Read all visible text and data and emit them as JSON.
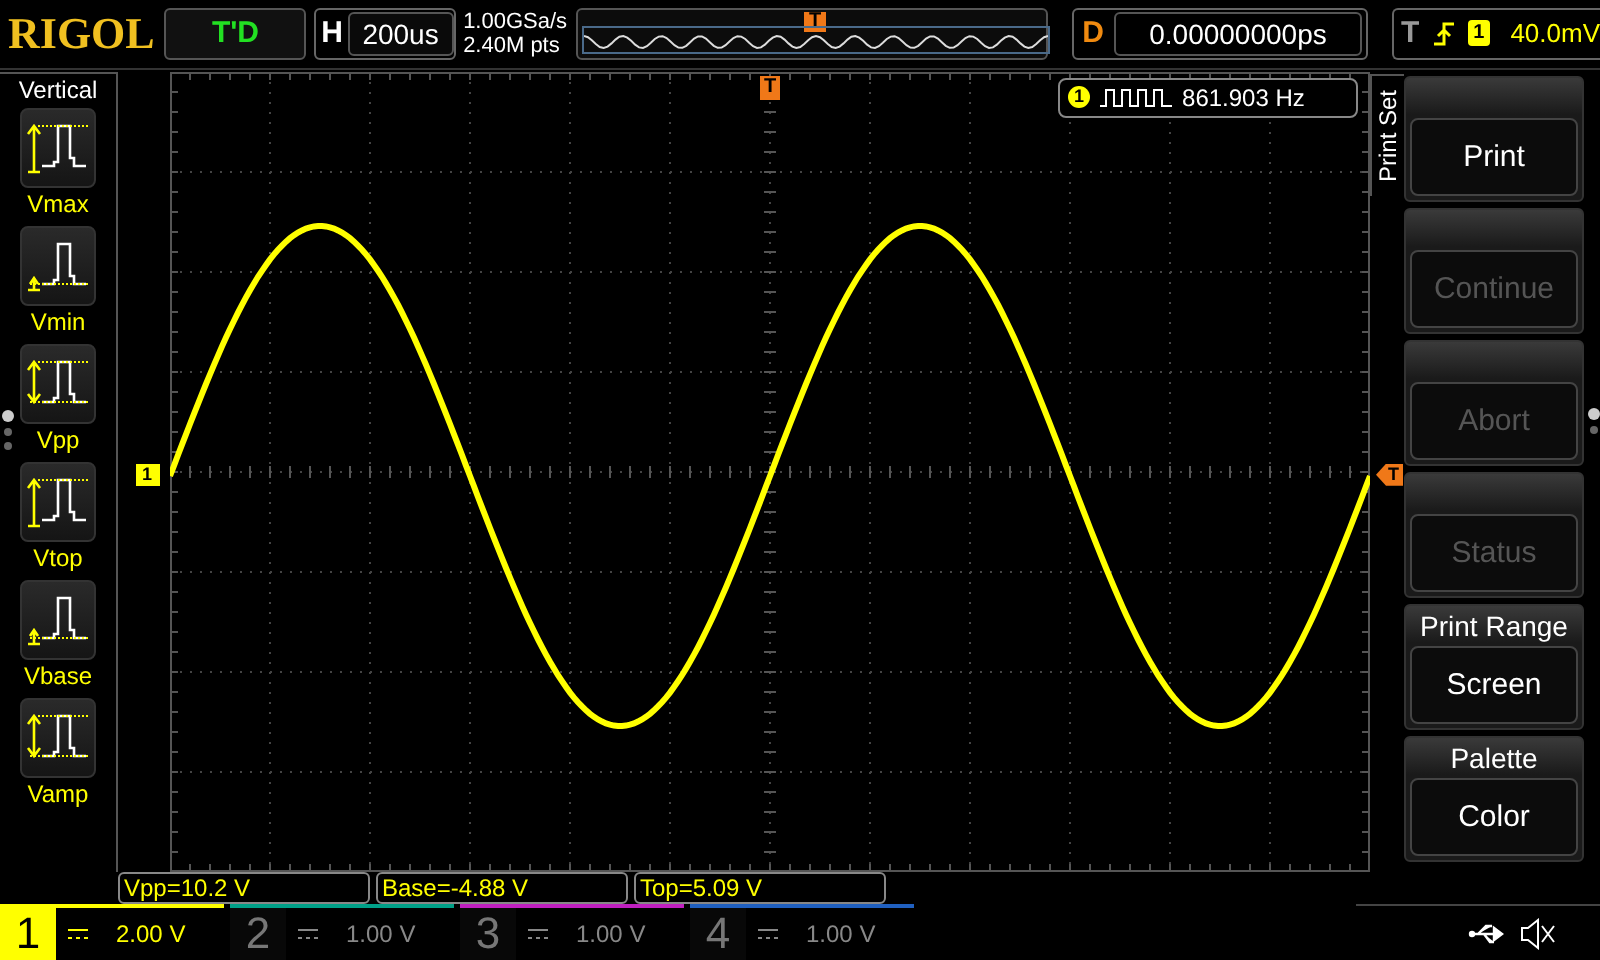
{
  "top_bar": {
    "logo": "RIGOL",
    "run_status": "T'D",
    "timebase": {
      "label": "H",
      "value": "200us"
    },
    "sample_rate": "1.00GSa/s",
    "memory_depth": "2.40M pts",
    "trigger_position_marker": "T",
    "delay": {
      "label": "D",
      "value": "0.00000000ps"
    },
    "trigger": {
      "label": "T",
      "source": "1",
      "level": "40.0mV"
    }
  },
  "left_menu": {
    "title": "Vertical",
    "items": [
      {
        "label": "Vmax",
        "kind": "max"
      },
      {
        "label": "Vmin",
        "kind": "min"
      },
      {
        "label": "Vpp",
        "kind": "pp"
      },
      {
        "label": "Vtop",
        "kind": "top"
      },
      {
        "label": "Vbase",
        "kind": "base"
      },
      {
        "label": "Vamp",
        "kind": "amp"
      }
    ],
    "pages": [
      {
        "selected": true
      },
      {
        "selected": false
      },
      {
        "selected": false
      }
    ]
  },
  "display": {
    "channel_marker": "1",
    "trigger_level_marker": "T",
    "trigger_time_marker": "T",
    "frequency": {
      "channel": "1",
      "value": "861.903 Hz"
    }
  },
  "right_menu": {
    "title": "Print Set",
    "items": [
      {
        "value": "Print",
        "disabled": false
      },
      {
        "value": "Continue",
        "disabled": true
      },
      {
        "value": "Abort",
        "disabled": true
      },
      {
        "value": "Status",
        "disabled": true
      },
      {
        "label": "Print Range",
        "value": "Screen",
        "disabled": false
      },
      {
        "label": "Palette",
        "value": "Color",
        "disabled": false
      }
    ],
    "pages": [
      {
        "selected": true
      },
      {
        "selected": false
      }
    ]
  },
  "measurements": [
    "Vpp=10.2 V",
    "Base=-4.88 V",
    "Top=5.09 V"
  ],
  "channels": [
    {
      "number": "1",
      "scale": "2.00 V",
      "on": true,
      "color": "#ffff00"
    },
    {
      "number": "2",
      "scale": "1.00 V",
      "on": false,
      "color": "#00a088"
    },
    {
      "number": "3",
      "scale": "1.00 V",
      "on": false,
      "color": "#c020c0"
    },
    {
      "number": "4",
      "scale": "1.00 V",
      "on": false,
      "color": "#2060c0"
    }
  ]
}
